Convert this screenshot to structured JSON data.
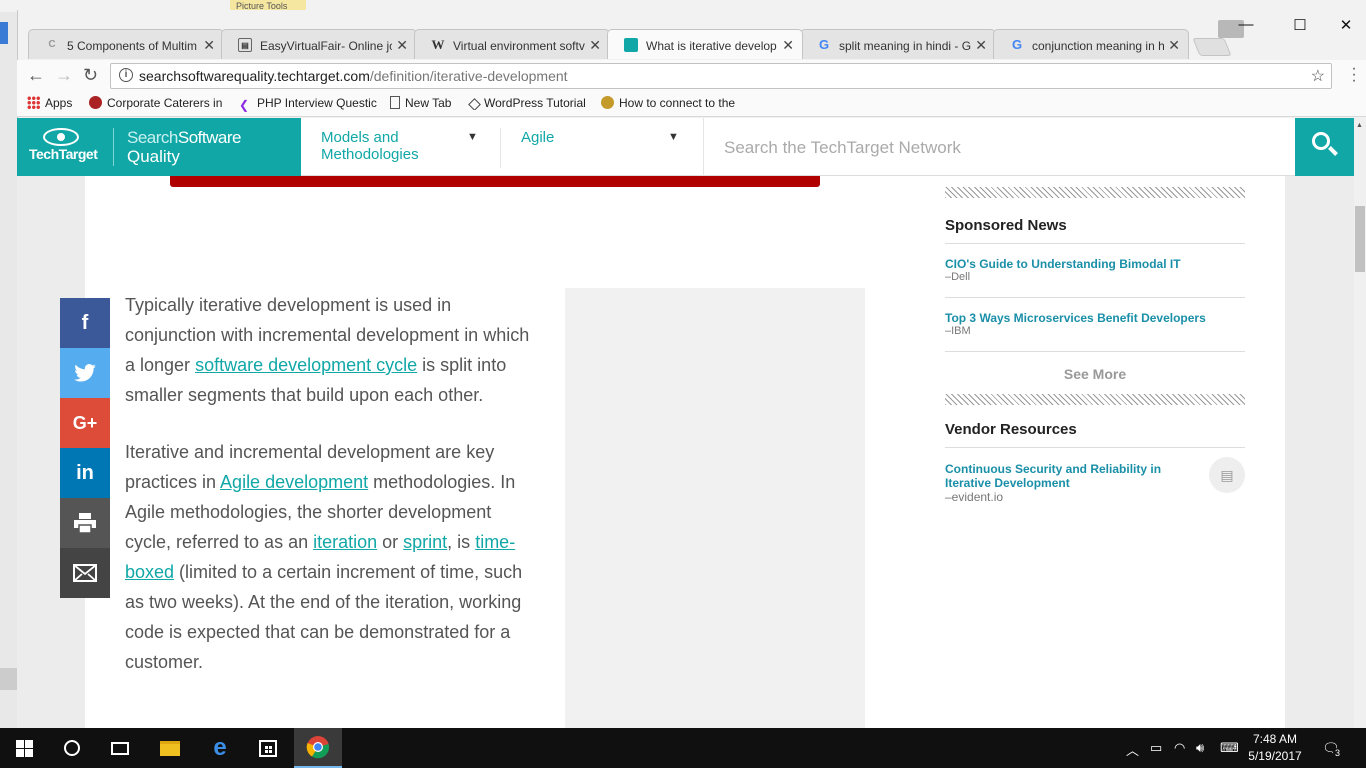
{
  "system": {
    "picture_tools": "Picture Tools"
  },
  "browser": {
    "tabs": [
      {
        "label": "5 Components of Multim",
        "icon": "generic-favicon",
        "active": false
      },
      {
        "label": "EasyVirtualFair- Online jc",
        "icon": "page-favicon",
        "active": false
      },
      {
        "label": "Virtual environment softv",
        "icon": "wikipedia-favicon",
        "active": false
      },
      {
        "label": "What is iterative develop",
        "icon": "techtarget-favicon",
        "active": true
      },
      {
        "label": "split meaning in hindi - G",
        "icon": "google-favicon",
        "active": false
      },
      {
        "label": "conjunction meaning in h",
        "icon": "google-favicon",
        "active": false
      }
    ],
    "url": {
      "host": "searchsoftwarequality.techtarget.com",
      "path": "/definition/iterative-development"
    },
    "bookmarks": [
      {
        "label": "Apps",
        "icon": "apps-grid-icon"
      },
      {
        "label": "Corporate Caterers in",
        "icon": "caterer-icon"
      },
      {
        "label": "PHP Interview Questic",
        "icon": "php-icon"
      },
      {
        "label": "New Tab",
        "icon": "page-icon"
      },
      {
        "label": "WordPress Tutorial",
        "icon": "wordpress-icon"
      },
      {
        "label": "How to connect to the",
        "icon": "connect-icon"
      }
    ]
  },
  "site": {
    "logo_text": "TechTarget",
    "brand_search": "Search",
    "brand_software": "Software",
    "brand_quality": "Quality",
    "nav": [
      {
        "label": "Models and Methodologies"
      },
      {
        "label": "Agile"
      }
    ],
    "search_placeholder": "Search the TechTarget Network",
    "accent": "#11a7a7"
  },
  "article": {
    "p1": {
      "before": "Typically iterative development is used in conjunction with incremental development in which a longer ",
      "link": "software development cycle",
      "after": " is split into smaller segments that build upon each other."
    },
    "p2": {
      "t1": "Iterative and incremental development are key practices in ",
      "l1": "Agile development",
      "t2": " methodologies. In Agile methodologies, the shorter development cycle, referred to as an ",
      "l2": "iteration",
      "t3": " or ",
      "l3": "sprint",
      "t4": ", is ",
      "l4": "time-boxed",
      "t5": " (limited to a certain increment of time, such as two weeks). At the end of the iteration, working code is expected that can be demonstrated for a customer."
    }
  },
  "social": [
    {
      "name": "facebook",
      "glyph": "f",
      "color": "#3b5998"
    },
    {
      "name": "twitter",
      "glyph": "🐦",
      "color": "#55acee"
    },
    {
      "name": "google-plus",
      "glyph": "G+",
      "color": "#dd4b39"
    },
    {
      "name": "linkedin",
      "glyph": "in",
      "color": "#0077b5"
    },
    {
      "name": "print",
      "glyph": "⎙",
      "color": "#555555"
    },
    {
      "name": "email",
      "glyph": "✉",
      "color": "#444444"
    }
  ],
  "sidebar": {
    "sponsored_heading": "Sponsored News",
    "news": [
      {
        "title": "CIO's Guide to Understanding Bimodal IT",
        "source": "–Dell"
      },
      {
        "title": "Top 3 Ways Microservices Benefit Developers",
        "source": "–IBM"
      }
    ],
    "see_more": "See More",
    "vendor_heading": "Vendor Resources",
    "vendor": {
      "title": "Continuous Security and Reliability in Iterative Development",
      "source": "–evident.io"
    }
  },
  "taskbar": {
    "time": "7:48 AM",
    "date": "5/19/2017",
    "notifications": "3"
  }
}
